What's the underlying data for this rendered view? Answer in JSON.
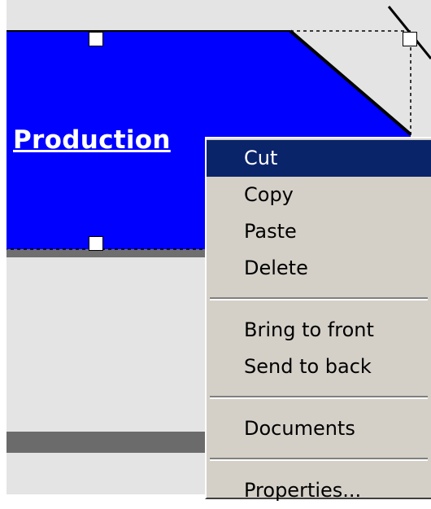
{
  "shape": {
    "label": "Production",
    "fill_color": "#0000ff",
    "label_color": "#ffffff"
  },
  "context_menu": {
    "items": [
      {
        "label": "Cut",
        "selected": true
      },
      {
        "label": "Copy"
      },
      {
        "label": "Paste"
      },
      {
        "label": "Delete"
      },
      {
        "label": "Bring to front"
      },
      {
        "label": "Send to back"
      },
      {
        "label": "Documents"
      },
      {
        "label": "Properties..."
      }
    ],
    "highlight_color": "#0a246a",
    "background_color": "#d4d0c8"
  }
}
